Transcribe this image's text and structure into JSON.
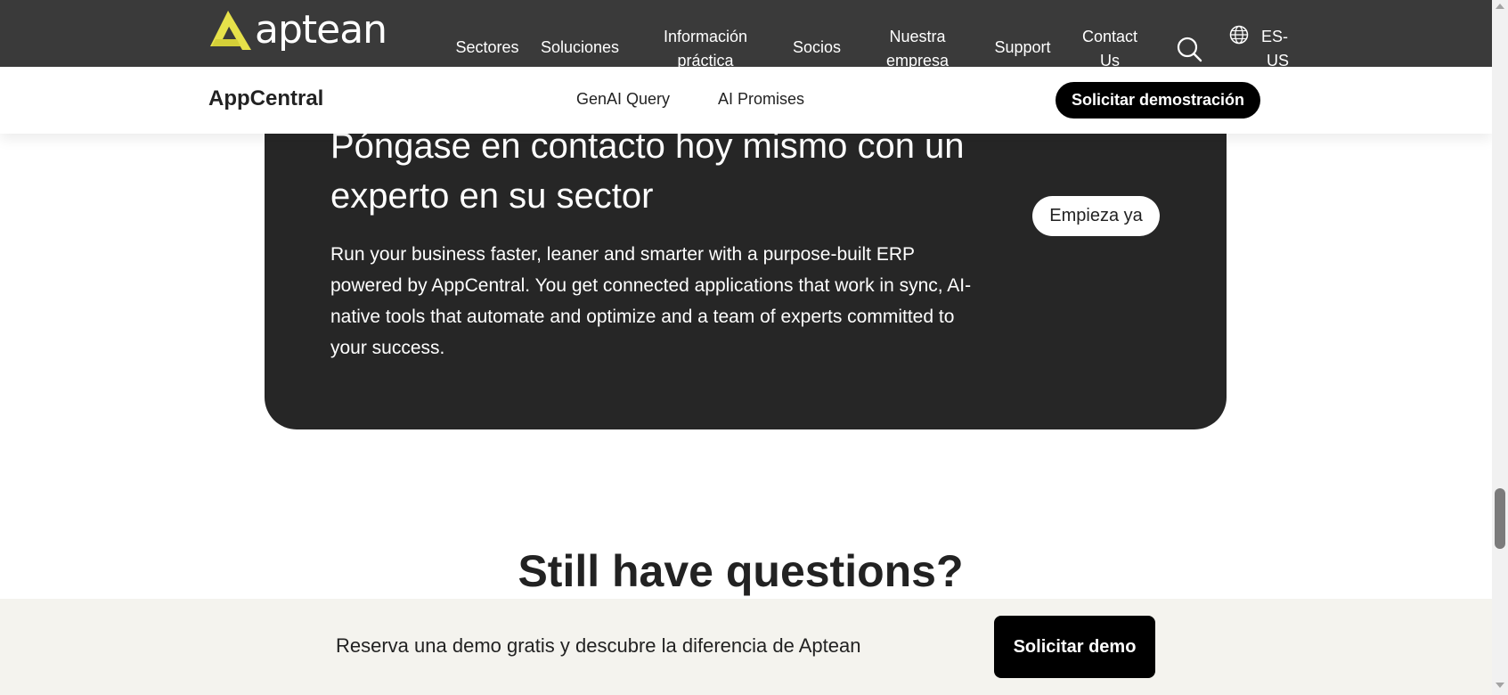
{
  "topnav": {
    "logo_text": "aptean",
    "items": [
      {
        "label_1": "Sectores",
        "label_2": ""
      },
      {
        "label_1": "Soluciones",
        "label_2": ""
      },
      {
        "label_1": "Información",
        "label_2": "práctica"
      },
      {
        "label_1": "Socios",
        "label_2": ""
      },
      {
        "label_1": "Nuestra",
        "label_2": "empresa"
      },
      {
        "label_1": "Support",
        "label_2": ""
      },
      {
        "label_1": "Contact",
        "label_2": "Us"
      }
    ],
    "lang_1": "ES-",
    "lang_2": "US"
  },
  "subnav": {
    "brand": "AppCentral",
    "links": [
      "GenAI Query",
      "AI Promises"
    ],
    "cta": "Solicitar demostración"
  },
  "card": {
    "title": "Póngase en contacto hoy mismo con un experto en su sector",
    "text": "Run your business faster, leaner and smarter with a purpose-built ERP powered by AppCentral. You get connected applications that work in sync, AI-native tools that automate and optimize and a team of experts committed to your success.",
    "button": "Empieza ya"
  },
  "questions": {
    "heading": "Still have questions?"
  },
  "sticky": {
    "text": "Reserva una demo gratis y descubre la diferencia de Aptean",
    "button": "Solicitar demo"
  },
  "colors": {
    "topnav_bg": "#3a3a3a",
    "logo_accent": "#e6e14a",
    "card_bg": "#262626",
    "sticky_bg": "#f4f3ee",
    "button_dark": "#000000"
  }
}
